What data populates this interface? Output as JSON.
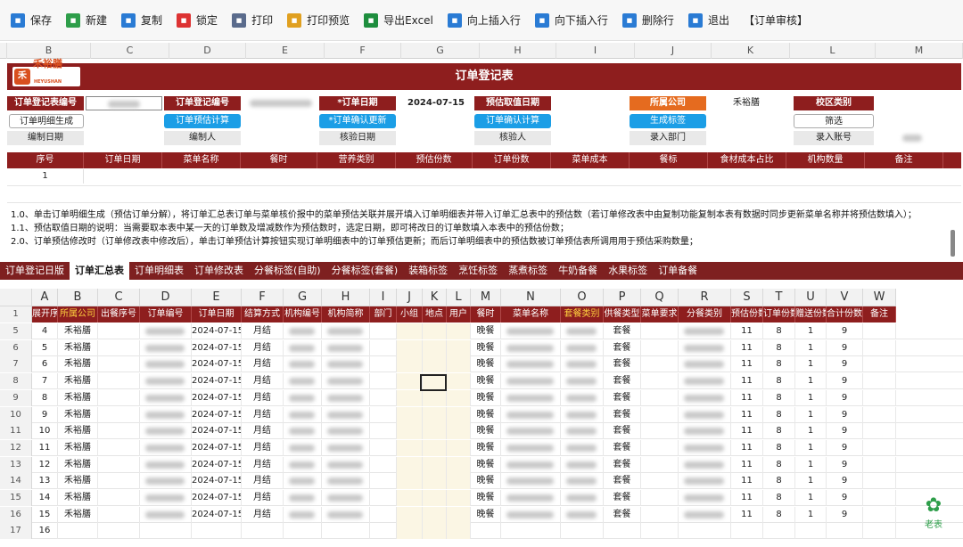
{
  "toolbar": [
    {
      "label": "保存",
      "icon": "save-icon",
      "color": "#2a7bd4"
    },
    {
      "label": "新建",
      "icon": "new-icon",
      "color": "#2e9e4a"
    },
    {
      "label": "复制",
      "icon": "copy-icon",
      "color": "#2a7bd4"
    },
    {
      "label": "锁定",
      "icon": "lock-icon",
      "color": "#d33"
    },
    {
      "label": "打印",
      "icon": "print-icon",
      "color": "#5a6b8c"
    },
    {
      "label": "打印预览",
      "icon": "print-preview-icon",
      "color": "#e0a020"
    },
    {
      "label": "导出Excel",
      "icon": "excel-icon",
      "color": "#1e8e3e"
    },
    {
      "label": "向上插入行",
      "icon": "insert-up-icon",
      "color": "#2a7bd4"
    },
    {
      "label": "向下插入行",
      "icon": "insert-down-icon",
      "color": "#2a7bd4"
    },
    {
      "label": "删除行",
      "icon": "delete-row-icon",
      "color": "#2a7bd4"
    },
    {
      "label": "退出",
      "icon": "exit-icon",
      "color": "#2a7bd4"
    },
    {
      "label": "【订单审核】",
      "icon": "",
      "color": ""
    }
  ],
  "top_columns": [
    "B",
    "C",
    "D",
    "E",
    "F",
    "G",
    "H",
    "I",
    "J",
    "K",
    "L",
    "M"
  ],
  "form": {
    "title": "订单登记表",
    "logo_text": "禾裕膳",
    "logo_sub": "HEYUSHAN",
    "reg_no_label": "订单登记表编号",
    "reg_id_label": "订单登记编号",
    "date_label": "*订单日期",
    "date_value": "2024-07-15",
    "est_date_label": "预估取值日期",
    "company_label": "所属公司",
    "company_value": "禾裕膳",
    "campus_label": "校区类别",
    "btn_detail": "订单明细生成",
    "btn_estimate": "订单预估计算",
    "btn_confirm_update": "*订单确认更新",
    "btn_confirm_calc": "订单确认计算",
    "btn_label": "生成标签",
    "btn_filter": "筛选",
    "edit_date": "编制日期",
    "editor": "编制人",
    "check_date": "核验日期",
    "checker": "核验人",
    "entry_dept": "录入部门",
    "entry_account": "录入账号"
  },
  "detail_headers": [
    "序号",
    "订单日期",
    "菜单名称",
    "餐时",
    "营养类别",
    "预估份数",
    "订单份数",
    "菜单成本",
    "餐标",
    "食材成本占比",
    "机构数量",
    "备注"
  ],
  "detail_row1": "1",
  "notes": [
    "1.0、单击订单明细生成（预估订单分解），将订单汇总表订单与菜单核价报中的菜单预估关联并展开填入订单明细表并带入订单汇总表中的预估数（若订单修改表中由复制功能复制本表有数据时同步更新菜单名称并将预估数填入）；",
    "1.1、预估取值日期的说明：当需要取本表中某一天的订单数及增减数作为预估数时，选定日期，即可将改日的订单数填入本表中的预估份数；",
    "2.0、订单预估修改时（订单修改表中修改后），单击订单预估计算按钮实现订单明细表中的订单预估更新；而后订单明细表中的预估数被订单预估表所调用用于预估采购数量；"
  ],
  "tabs": [
    "订单登记日版",
    "订单汇总表",
    "订单明细表",
    "订单修改表",
    "分餐标签(自助)",
    "分餐标签(套餐)",
    "装箱标签",
    "烹饪标签",
    "蒸煮标签",
    "牛奶备餐",
    "水果标签",
    "订单备餐"
  ],
  "active_tab": "订单汇总表",
  "sheet_columns": [
    "A",
    "B",
    "C",
    "D",
    "E",
    "F",
    "G",
    "H",
    "I",
    "J",
    "K",
    "L",
    "M",
    "N",
    "O",
    "P",
    "Q",
    "R",
    "S",
    "T",
    "U",
    "V",
    "W"
  ],
  "sheet_headers": [
    "展开序号",
    "所属公司",
    "出餐序号",
    "订单编号",
    "订单日期",
    "结算方式",
    "机构编号",
    "机构简称",
    "部门",
    "小组",
    "地点",
    "用户",
    "餐时",
    "菜单名称",
    "套餐类别",
    "供餐类型",
    "菜单要求",
    "分餐类别",
    "预估份数",
    "订单份数",
    "赠送份数",
    "合计份数",
    "备注"
  ],
  "rows": [
    {
      "row": "5",
      "no": "4",
      "company": "禾裕膳",
      "date": "2024-07-15",
      "settle": "月结",
      "meal": "晚餐",
      "type": "套餐",
      "est": "11",
      "ord": "8",
      "gift": "1",
      "total": "9"
    },
    {
      "row": "6",
      "no": "5",
      "company": "禾裕膳",
      "date": "2024-07-15",
      "settle": "月结",
      "meal": "晚餐",
      "type": "套餐",
      "est": "11",
      "ord": "8",
      "gift": "1",
      "total": "9"
    },
    {
      "row": "7",
      "no": "6",
      "company": "禾裕膳",
      "date": "2024-07-15",
      "settle": "月结",
      "meal": "晚餐",
      "type": "套餐",
      "est": "11",
      "ord": "8",
      "gift": "1",
      "total": "9"
    },
    {
      "row": "8",
      "no": "7",
      "company": "禾裕膳",
      "date": "2024-07-15",
      "settle": "月结",
      "meal": "晚餐",
      "type": "套餐",
      "est": "11",
      "ord": "8",
      "gift": "1",
      "total": "9"
    },
    {
      "row": "9",
      "no": "8",
      "company": "禾裕膳",
      "date": "2024-07-15",
      "settle": "月结",
      "meal": "晚餐",
      "type": "套餐",
      "est": "11",
      "ord": "8",
      "gift": "1",
      "total": "9"
    },
    {
      "row": "10",
      "no": "9",
      "company": "禾裕膳",
      "date": "2024-07-15",
      "settle": "月结",
      "meal": "晚餐",
      "type": "套餐",
      "est": "11",
      "ord": "8",
      "gift": "1",
      "total": "9"
    },
    {
      "row": "11",
      "no": "10",
      "company": "禾裕膳",
      "date": "2024-07-15",
      "settle": "月结",
      "meal": "晚餐",
      "type": "套餐",
      "est": "11",
      "ord": "8",
      "gift": "1",
      "total": "9"
    },
    {
      "row": "12",
      "no": "11",
      "company": "禾裕膳",
      "date": "2024-07-15",
      "settle": "月结",
      "meal": "晚餐",
      "type": "套餐",
      "est": "11",
      "ord": "8",
      "gift": "1",
      "total": "9"
    },
    {
      "row": "13",
      "no": "12",
      "company": "禾裕膳",
      "date": "2024-07-15",
      "settle": "月结",
      "meal": "晚餐",
      "type": "套餐",
      "est": "11",
      "ord": "8",
      "gift": "1",
      "total": "9"
    },
    {
      "row": "14",
      "no": "13",
      "company": "禾裕膳",
      "date": "2024-07-15",
      "settle": "月结",
      "meal": "晚餐",
      "type": "套餐",
      "est": "11",
      "ord": "8",
      "gift": "1",
      "total": "9"
    },
    {
      "row": "15",
      "no": "14",
      "company": "禾裕膳",
      "date": "2024-07-15",
      "settle": "月结",
      "meal": "晚餐",
      "type": "套餐",
      "est": "11",
      "ord": "8",
      "gift": "1",
      "total": "9"
    },
    {
      "row": "16",
      "no": "15",
      "company": "禾裕膳",
      "date": "2024-07-15",
      "settle": "月结",
      "meal": "晚餐",
      "type": "套餐",
      "est": "11",
      "ord": "8",
      "gift": "1",
      "total": "9"
    },
    {
      "row": "17",
      "no": "16",
      "company": "",
      "date": "",
      "settle": "",
      "meal": "",
      "type": "",
      "est": "",
      "ord": "",
      "gift": "",
      "total": ""
    }
  ],
  "header_row_num": "1",
  "watermark": "老表"
}
